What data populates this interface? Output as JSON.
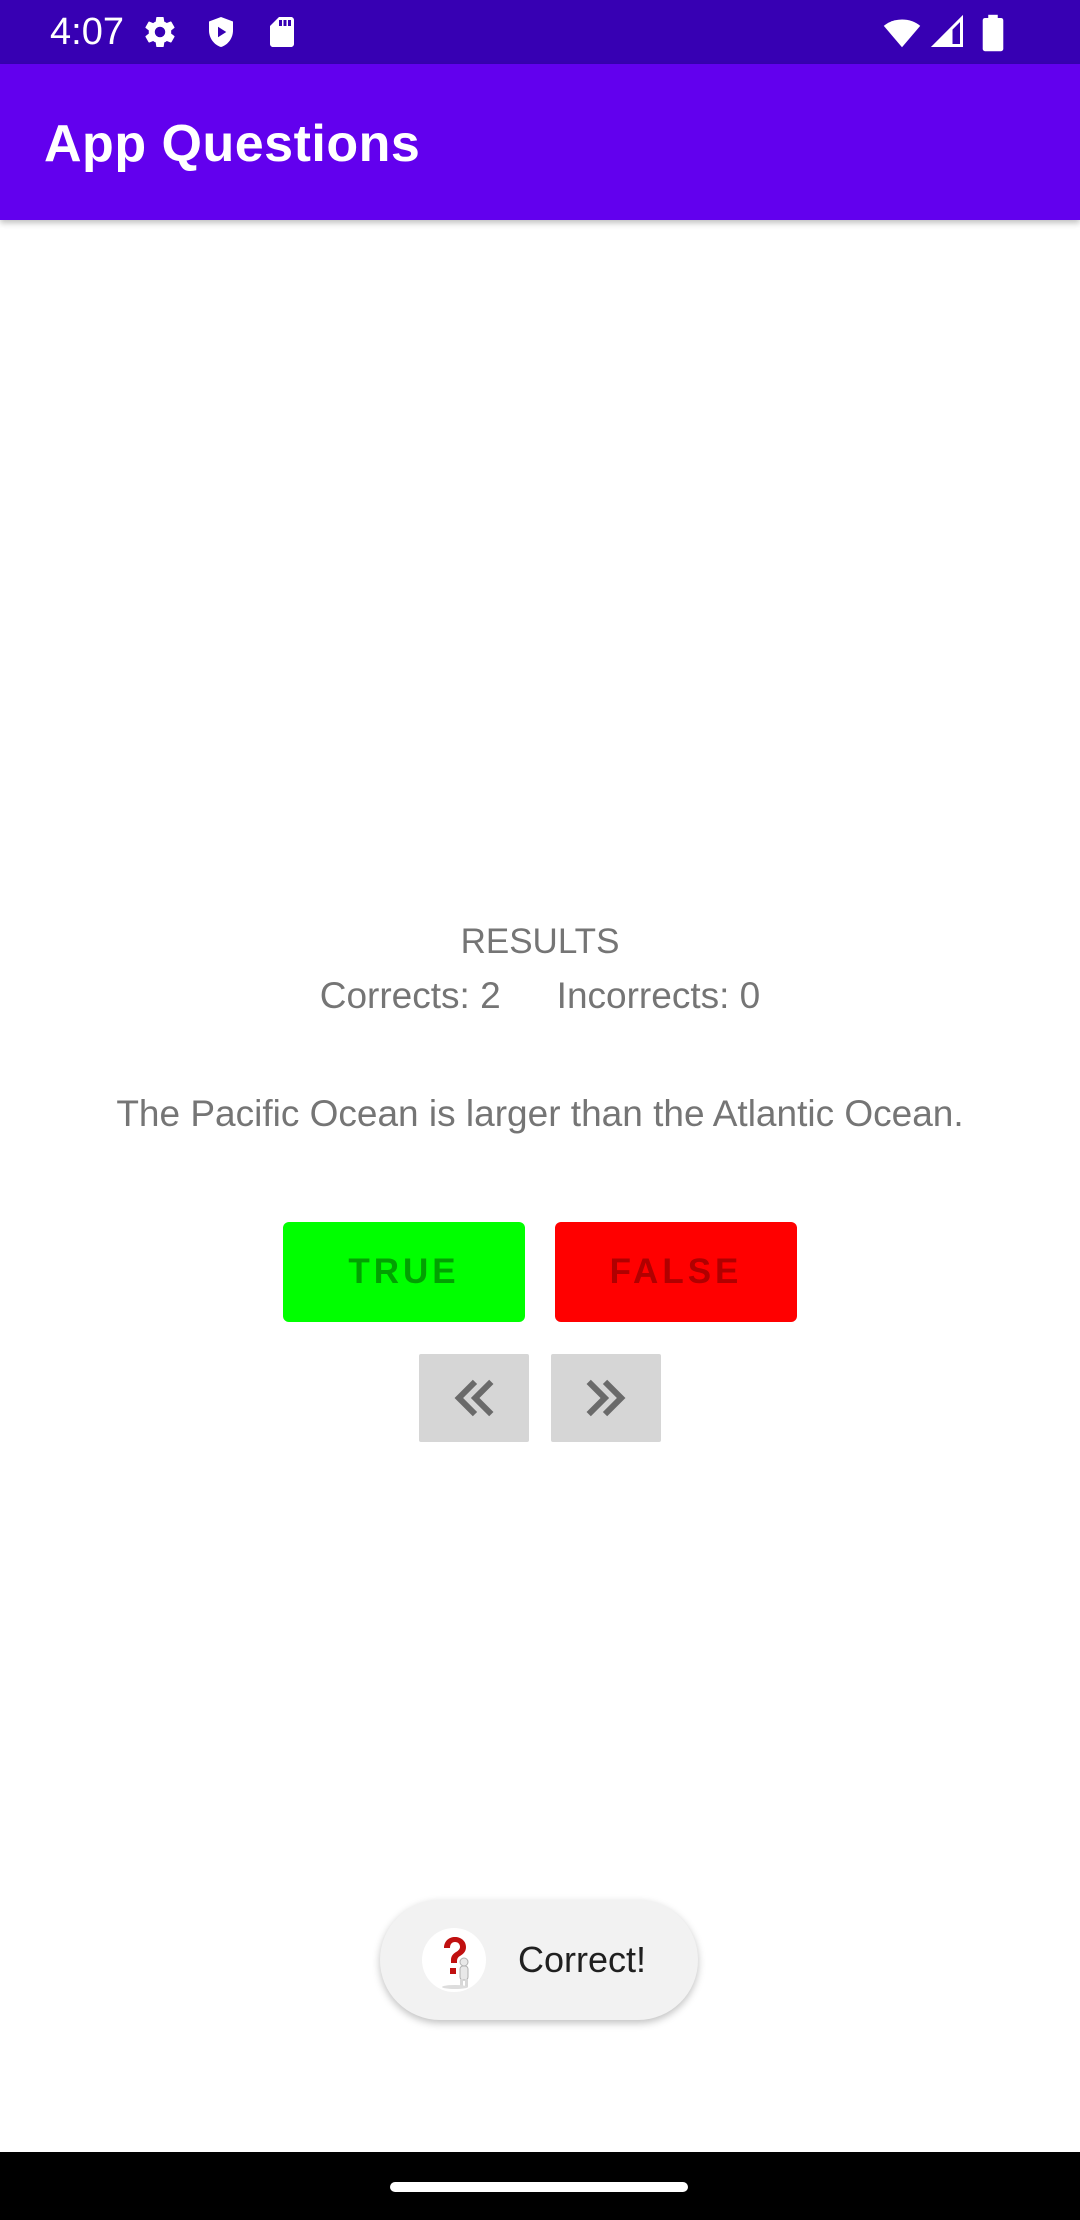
{
  "status_bar": {
    "time": "4:07",
    "icons_left": [
      "settings-gear-icon",
      "shield-play-icon",
      "sd-card-icon"
    ],
    "icons_right": [
      "wifi-icon",
      "cell-signal-icon",
      "battery-icon"
    ]
  },
  "app_bar": {
    "title": "App Questions",
    "color": "#6200ee"
  },
  "results": {
    "heading": "RESULTS",
    "corrects": "Corrects: 2",
    "incorrects": "Incorrects: 0"
  },
  "question": {
    "text": "The Pacific Ocean is larger than the Atlantic Ocean."
  },
  "answers": {
    "true_label": "TRUE",
    "false_label": "FALSE",
    "true_color": "#00ff00",
    "false_color": "#ff0000"
  },
  "navigation": {
    "prev_icon": "double-chevron-left-icon",
    "next_icon": "double-chevron-right-icon"
  },
  "toast": {
    "message": "Correct!",
    "icon": "question-mark-figure-icon"
  }
}
